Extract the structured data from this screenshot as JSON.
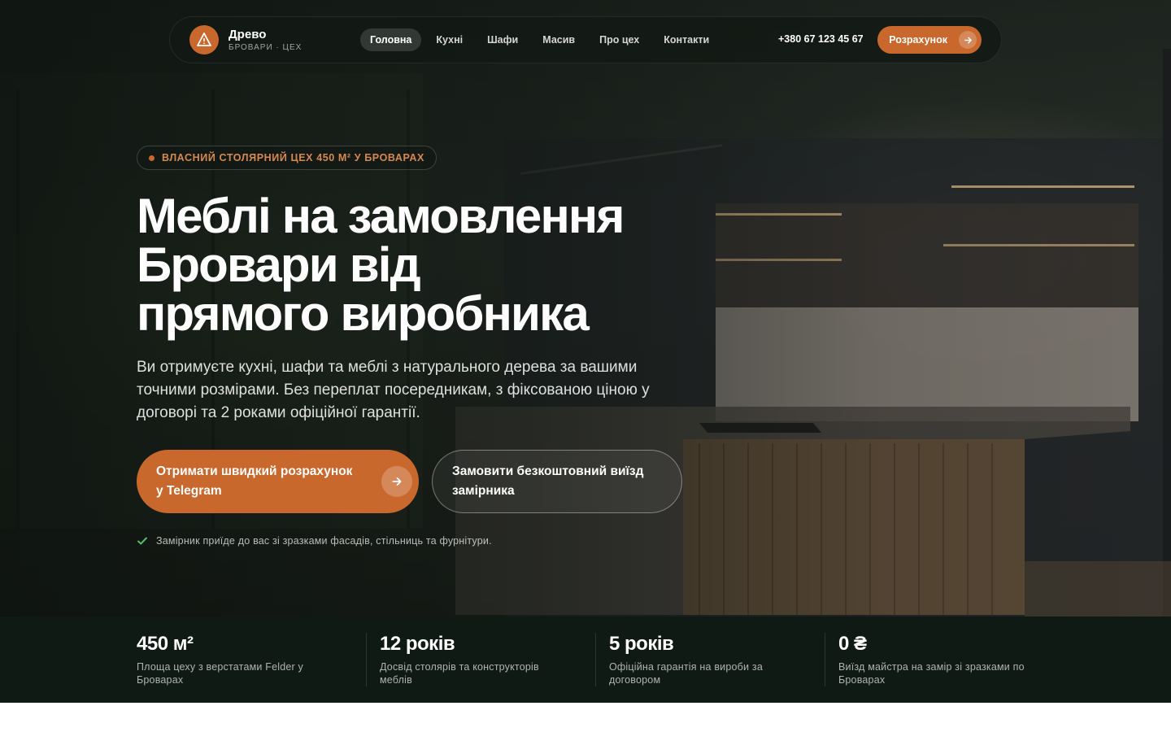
{
  "brand": {
    "name": "Древо",
    "subtitle": "БРОВАРИ · ЦЕХ",
    "accent_color": "#c9682d",
    "dark_color": "#0f1a15"
  },
  "nav": {
    "items": [
      {
        "label": "Головна",
        "active": true
      },
      {
        "label": "Кухні",
        "active": false
      },
      {
        "label": "Шафи",
        "active": false
      },
      {
        "label": "Масив",
        "active": false
      },
      {
        "label": "Про цех",
        "active": false
      },
      {
        "label": "Контакти",
        "active": false
      }
    ],
    "phone": "+380 67 123 45 67",
    "cta_label": "Розрахунок"
  },
  "hero": {
    "badge": "ВЛАСНИЙ СТОЛЯРНИЙ ЦЕХ 450 М² У БРОВАРАХ",
    "headline_lines": [
      "Меблі на замовлення",
      "Бровари від",
      "прямого виробника"
    ],
    "lead_lines": [
      "Ви отримуєте кухні, шафи та меблі з натурального дерева за вашими",
      "точними розмірами. Без переплат посередникам, з фіксованою ціною у",
      "договорі та 2 роками офіційної гарантії."
    ],
    "primary_button_lines": [
      "Отримати швидкий розрахунок",
      "у Telegram"
    ],
    "secondary_button_lines": [
      "Замовити безкоштовний виїзд",
      "замірника"
    ],
    "note": "Замірник приїде до вас зі зразками фасадів, стільниць та фурнітури."
  },
  "stats": [
    {
      "value": "450 м²",
      "desc_lines": [
        "Площа цеху з верстатами Felder у",
        "Броварах"
      ]
    },
    {
      "value": "12 років",
      "desc_lines": [
        "Досвід столярів та конструкторів",
        "меблів"
      ]
    },
    {
      "value": "5 років",
      "desc_lines": [
        "Офіційна гарантія на вироби за",
        "договором"
      ]
    },
    {
      "value": "0 ₴",
      "desc_lines": [
        "Виїзд майстра на замір зі зразками по",
        "Броварах"
      ]
    }
  ],
  "icons": {
    "logo": "triangle-warning-icon",
    "arrow": "arrow-right-icon",
    "check": "check-icon"
  }
}
